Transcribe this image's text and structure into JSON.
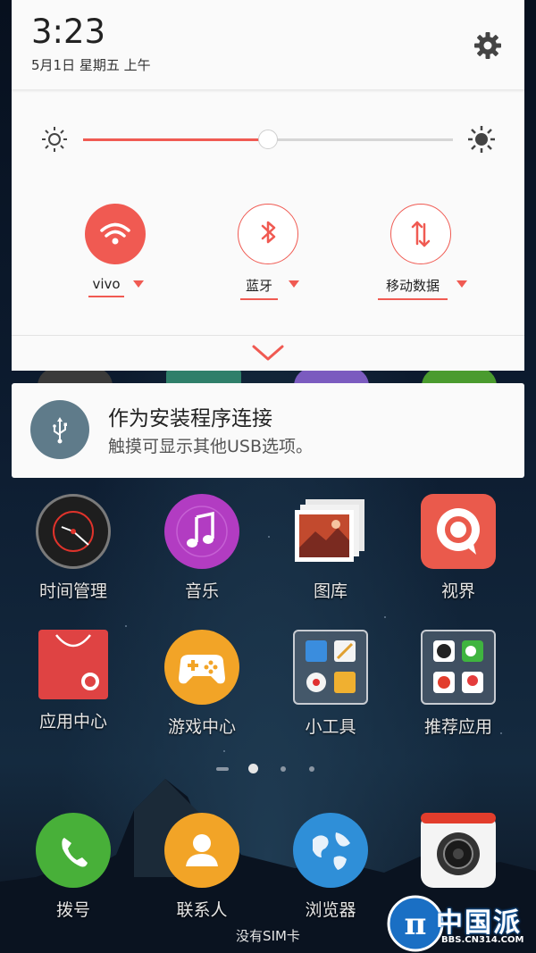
{
  "status": {
    "time": "3:23",
    "date": "5月1日 星期五 上午"
  },
  "brightness": {
    "level": 0.5
  },
  "toggles": [
    {
      "label": "vivo",
      "icon": "wifi-icon",
      "state": "on"
    },
    {
      "label": "蓝牙",
      "icon": "bluetooth-icon",
      "state": "off"
    },
    {
      "label": "移动数据",
      "icon": "mobile-data-icon",
      "state": "off"
    }
  ],
  "notification": {
    "title": "作为安装程序连接",
    "body": "触摸可显示其他USB选项。",
    "icon": "usb-icon"
  },
  "apps": {
    "row1": [
      "时间管理",
      "音乐",
      "图库",
      "视界"
    ],
    "row2": [
      "应用中心",
      "游戏中心",
      "小工具",
      "推荐应用"
    ]
  },
  "dock": [
    "拨号",
    "联系人",
    "浏览器"
  ],
  "sim_status": "没有SIM卡",
  "watermark": {
    "text": "中国派",
    "url": "BBS.CN314.COM"
  },
  "colors": {
    "accent": "#f05a52",
    "notif_icon": "#5f7b8a"
  }
}
